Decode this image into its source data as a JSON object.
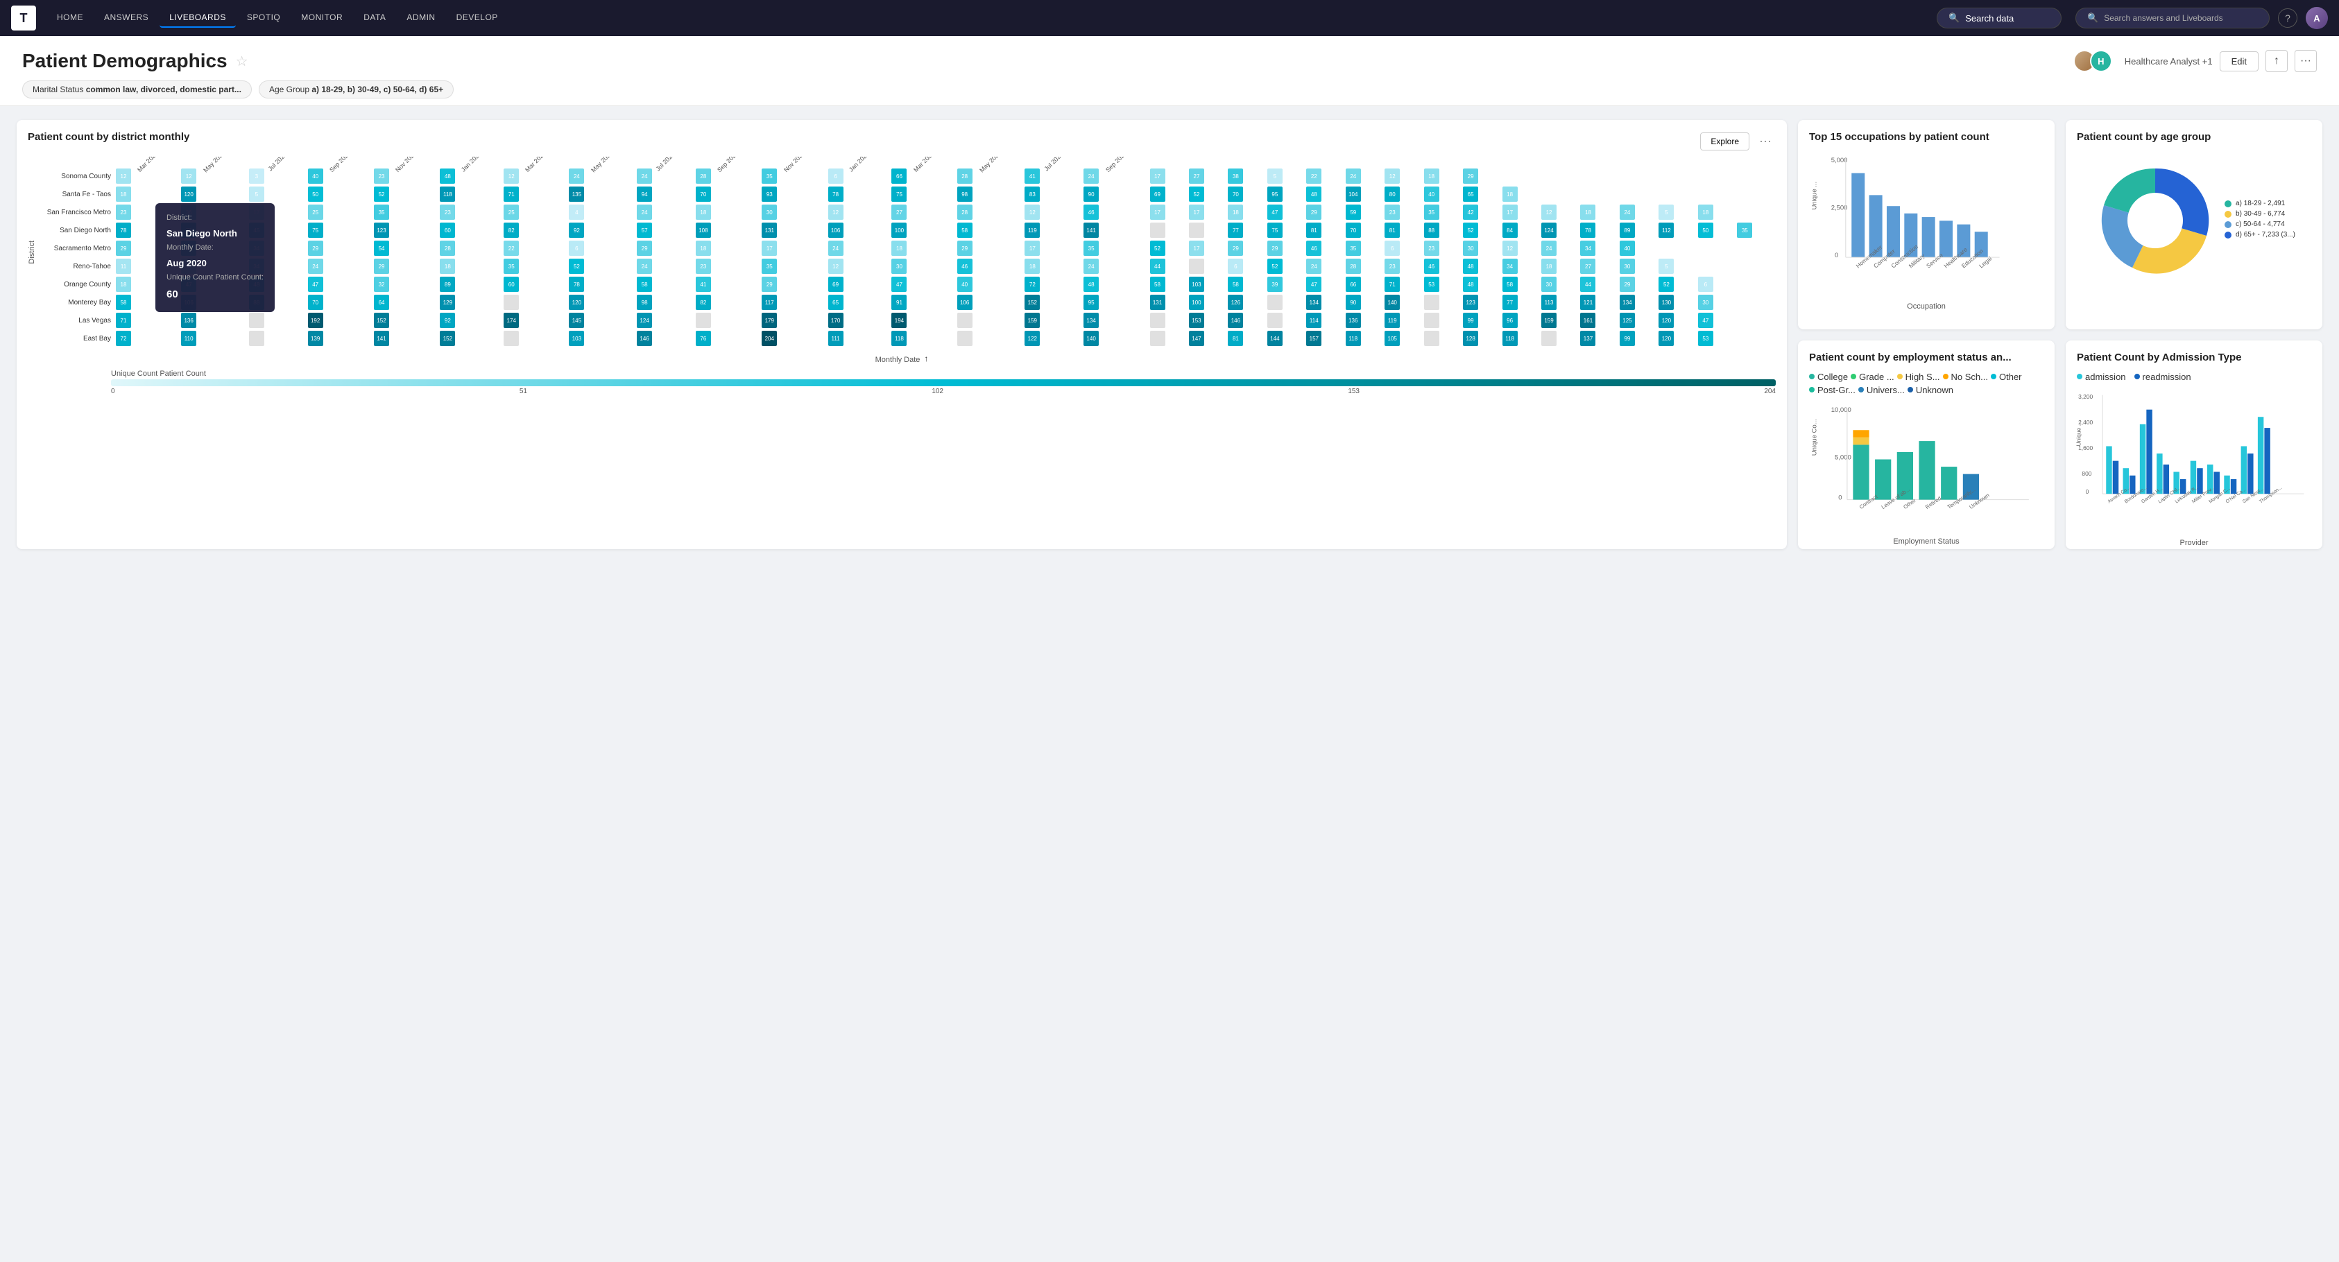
{
  "nav": {
    "logo": "T",
    "items": [
      "HOME",
      "ANSWERS",
      "LIVEBOARDS",
      "SPOTIQ",
      "MONITOR",
      "DATA",
      "ADMIN",
      "DEVELOP"
    ],
    "active": "LIVEBOARDS",
    "search_center": "Search data",
    "search_right": "Search answers and Liveboards"
  },
  "page": {
    "title": "Patient Demographics",
    "analyst": "Healthcare Analyst +1",
    "edit_label": "Edit",
    "filters": [
      "Marital Status common law, divorced, domestic part...",
      "Age Group a) 18-29, b) 30-49, c) 50-64, d) 65+"
    ]
  },
  "heatmap": {
    "title": "Patient count by district monthly",
    "explore_label": "Explore",
    "x_axis": "Monthly Date",
    "y_axis": "District",
    "legend_min": "0",
    "legend_mid1": "51",
    "legend_mid2": "102",
    "legend_mid3": "153",
    "legend_max": "204",
    "districts": [
      "Sonoma County",
      "Santa Fe - Taos",
      "San Francisco Metro",
      "San Diego North",
      "Sacramento Metro",
      "Reno-Tahoe",
      "Orange County",
      "Monterey Bay",
      "Las Vegas",
      "East Bay"
    ],
    "tooltip": {
      "district_label": "District:",
      "district_val": "San Diego North",
      "date_label": "Monthly Date:",
      "date_val": "Aug 2020",
      "count_label": "Unique Count Patient Count:",
      "count_val": "60"
    }
  },
  "occupations": {
    "title": "Top 15 occupations by patient count",
    "x_axis": "Occupation",
    "y_axis": "Unique ...",
    "y_max": "5,000",
    "y_mid": "2,500",
    "y_min": "0",
    "bars": [
      "Homemaker",
      "Computer",
      "Construction",
      "Military",
      "Service",
      "Healthcare",
      "Education",
      "Legal"
    ]
  },
  "age_group": {
    "title": "Patient count by age group",
    "segments": [
      {
        "label": "a) 18-29 - 2,491",
        "pct": "11.71%",
        "color": "#26b5a0"
      },
      {
        "label": "b) 30-49 - 6,774",
        "pct": "31.84%",
        "color": "#f5c842"
      },
      {
        "label": "c) 50-64 - 4,774",
        "pct": "22.44%",
        "color": "#5b9bd5"
      },
      {
        "label": "d) 65+ - 7,233 (3...)",
        "pct": "34.01%",
        "color": "#2563d4"
      }
    ]
  },
  "employment": {
    "title": "Patient count by employment status an...",
    "x_axis": "Employment Status",
    "y_max": "10,000",
    "y_mid": "5,000",
    "y_min": "0",
    "statuses": [
      "Contract",
      "Leave of ab...",
      "Other",
      "Retired",
      "Temporarily...",
      "Unknown"
    ],
    "legend": [
      {
        "label": "College",
        "color": "#26b5a0"
      },
      {
        "label": "Grade ...",
        "color": "#2ecc71"
      },
      {
        "label": "High S...",
        "color": "#f5c842"
      },
      {
        "label": "No Sch...",
        "color": "#ffa500"
      },
      {
        "label": "Other",
        "color": "#00bcd4"
      },
      {
        "label": "Post-Gr...",
        "color": "#1abc9c"
      },
      {
        "label": "Univers...",
        "color": "#2980b9"
      },
      {
        "label": "Unknown",
        "color": "#1a5fa8"
      }
    ]
  },
  "admission": {
    "title": "Patient Count by Admission Type",
    "x_axis": "Provider",
    "y_max": "3,200",
    "y_vals": [
      "3,200",
      "2,400",
      "1,600",
      "800",
      "0"
    ],
    "providers": [
      "Avrach Co...",
      "Bordonaro...",
      "Garden H...",
      "Laplin Chil...",
      "LeKodak R...",
      "Miller Prev...",
      "Morgan C...",
      "O'Nel Ca...",
      "San Nicol...",
      "Thompson..."
    ],
    "legend": [
      {
        "label": "admission",
        "color": "#26c6da"
      },
      {
        "label": "readmission",
        "color": "#1565c0"
      }
    ]
  }
}
